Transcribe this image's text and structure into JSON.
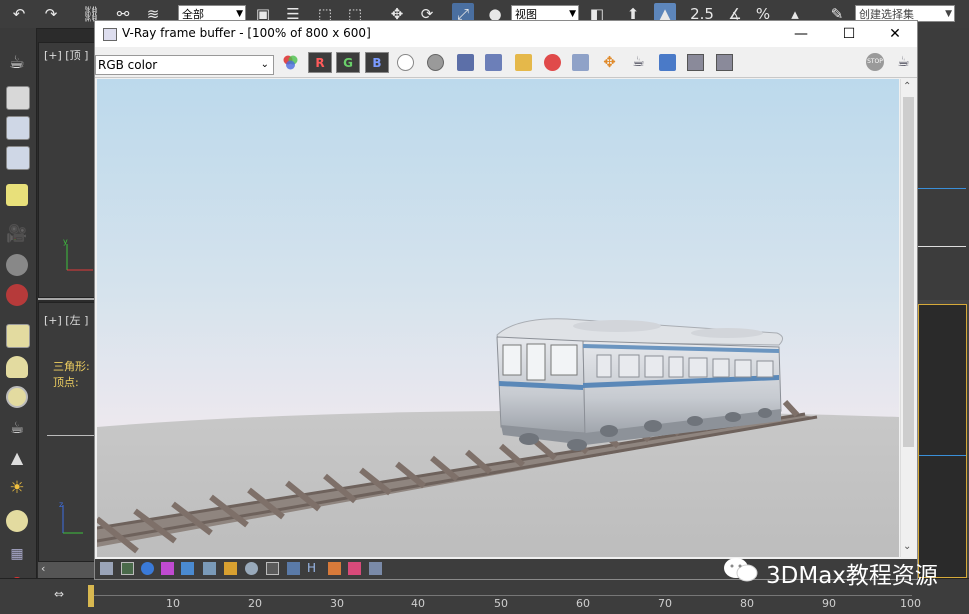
{
  "toolbar": {
    "selection_filter": "全部",
    "view_coord": "视图",
    "snap_value": "2.5",
    "percent_label": "%",
    "named_selection_placeholder": "创建选择集"
  },
  "viewports": {
    "top_label": "[+] [顶 ]",
    "left_label": "[+] [左 ]",
    "stats_triangles": "三角形:",
    "stats_vertices": "顶点:"
  },
  "vray": {
    "title": "V-Ray frame buffer - [100% of 800 x 600]",
    "channel": "RGB color",
    "channel_r": "R",
    "channel_g": "G",
    "channel_b": "B",
    "status_h": "H",
    "stop_label": "STOP"
  },
  "timeline": {
    "ticks": [
      "10",
      "20",
      "30",
      "40",
      "50",
      "60",
      "70",
      "80",
      "90",
      "100"
    ]
  },
  "watermark": {
    "text": "3DMax教程资源"
  },
  "colors": {
    "app_bg": "#2b2b2b",
    "toolbar_bg": "#3d3d3d",
    "sky_top": "#bcd9ec",
    "ground": "#c8c8c8",
    "rail": "#7b6e67",
    "train_stripe": "#5a88b8"
  }
}
